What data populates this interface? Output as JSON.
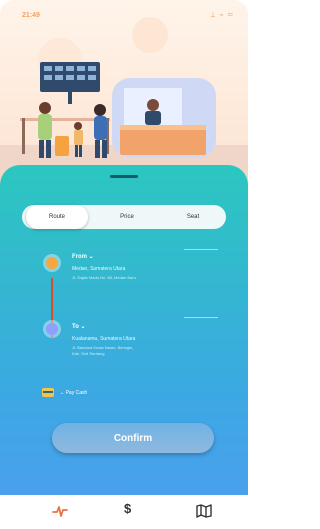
{
  "status": {
    "time": "21:49",
    "icons": "⟂ ⌁ ▭"
  },
  "tabs": [
    {
      "label": "Route"
    },
    {
      "label": "Price"
    },
    {
      "label": "Seat"
    }
  ],
  "from": {
    "label": "From ⌄",
    "title": "Medan, Sumatera Utara",
    "address": "Jl. Gajah Mada No. 88, Medan Baru"
  },
  "to": {
    "label": "To ⌄",
    "title": "Kualanamu, Sumatera Utara",
    "address_line1": "Jl. Bandara Kuala Namu, Beringin,",
    "address_line2": "Kab. Deli Serdang"
  },
  "payment": {
    "label": "⌄  Pay Cash"
  },
  "confirm_label": "Confirm",
  "bottom_nav": {
    "dollar": "$"
  },
  "colors": {
    "accent": "#f2a060",
    "sheet_top": "#2bc7c0",
    "sheet_bottom": "#4aa0ec",
    "from_dot": "#f6a740",
    "to_dot": "#8fa0ff"
  }
}
